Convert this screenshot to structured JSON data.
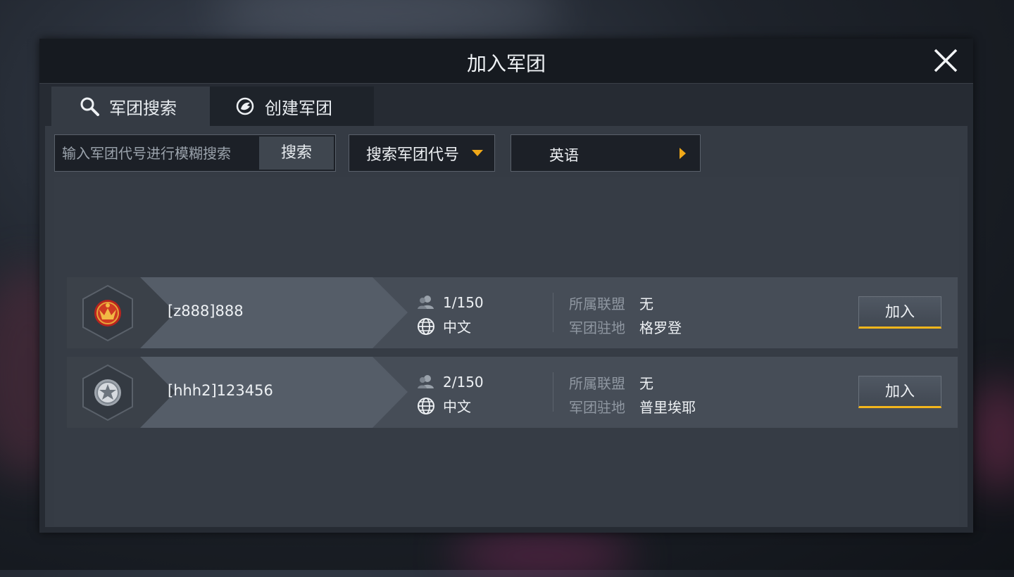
{
  "dialog": {
    "title": "加入军团"
  },
  "tabs": [
    {
      "label": "军团搜索",
      "icon": "search-icon",
      "active": true
    },
    {
      "label": "创建军团",
      "icon": "create-legion-icon",
      "active": false
    }
  ],
  "search": {
    "placeholder": "输入军团代号进行模糊搜索",
    "button_label": "搜索",
    "type_dropdown": "搜索军团代号",
    "language_dropdown": "英语"
  },
  "colors": {
    "accent": "#f2b51c",
    "panel": "#353b44",
    "titlebar": "#161a20"
  },
  "legions": [
    {
      "name": "[z888]888",
      "emblem": "red-phoenix-emblem",
      "members": "1/150",
      "language": "中文",
      "alliance_label": "所属联盟",
      "alliance_value": "无",
      "base_label": "军团驻地",
      "base_value": "格罗登",
      "join_label": "加入"
    },
    {
      "name": "[hhh2]123456",
      "emblem": "silver-star-emblem",
      "members": "2/150",
      "language": "中文",
      "alliance_label": "所属联盟",
      "alliance_value": "无",
      "base_label": "军团驻地",
      "base_value": "普里埃耶",
      "join_label": "加入"
    }
  ]
}
